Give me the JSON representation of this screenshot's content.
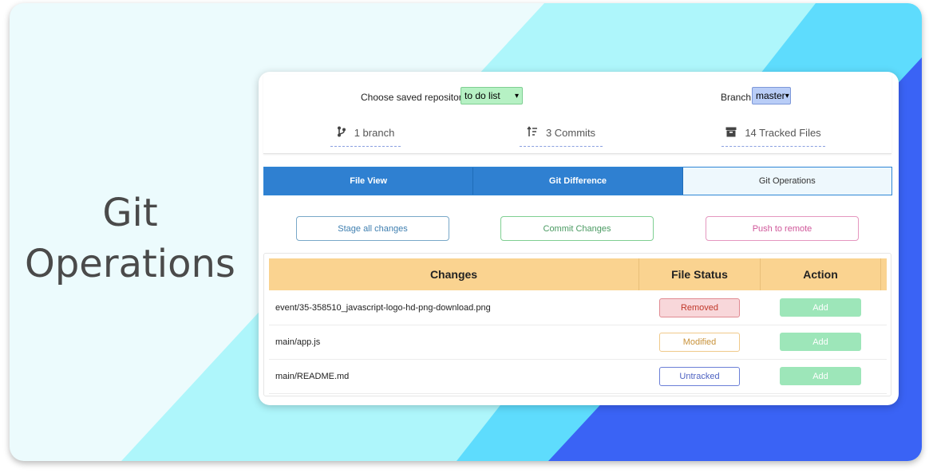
{
  "hero": {
    "line1": "Git",
    "line2": "Operations"
  },
  "repo": {
    "choose_label": "Choose saved repository",
    "selected_repo": "to do list",
    "branch_label": "Branch",
    "selected_branch": "master"
  },
  "stats": {
    "branches": "1 branch",
    "commits": "3 Commits",
    "tracked": "14 Tracked Files"
  },
  "tabs": [
    {
      "label": "File View"
    },
    {
      "label": "Git Difference"
    },
    {
      "label": "Git Operations"
    }
  ],
  "actions": {
    "stage": "Stage all changes",
    "commit": "Commit Changes",
    "push": "Push to remote"
  },
  "table": {
    "headers": [
      "Changes",
      "File Status",
      "Action"
    ],
    "rows": [
      {
        "file": "event/35-358510_javascript-logo-hd-png-download.png",
        "status": "Removed",
        "action": "Add"
      },
      {
        "file": "main/app.js",
        "status": "Modified",
        "action": "Add"
      },
      {
        "file": "main/README.md",
        "status": "Untracked",
        "action": "Add"
      }
    ]
  },
  "colors": {
    "tab_active": "#2f80d1",
    "header_bg": "#fad390",
    "removed": "#f8d7da",
    "modified": "#f0c98a",
    "untracked": "#6b7fd7",
    "add_button": "#9de6b9"
  },
  "icons": {
    "branch": "git-branch-icon",
    "commits": "commits-icon",
    "tracked": "archive-box-icon"
  }
}
